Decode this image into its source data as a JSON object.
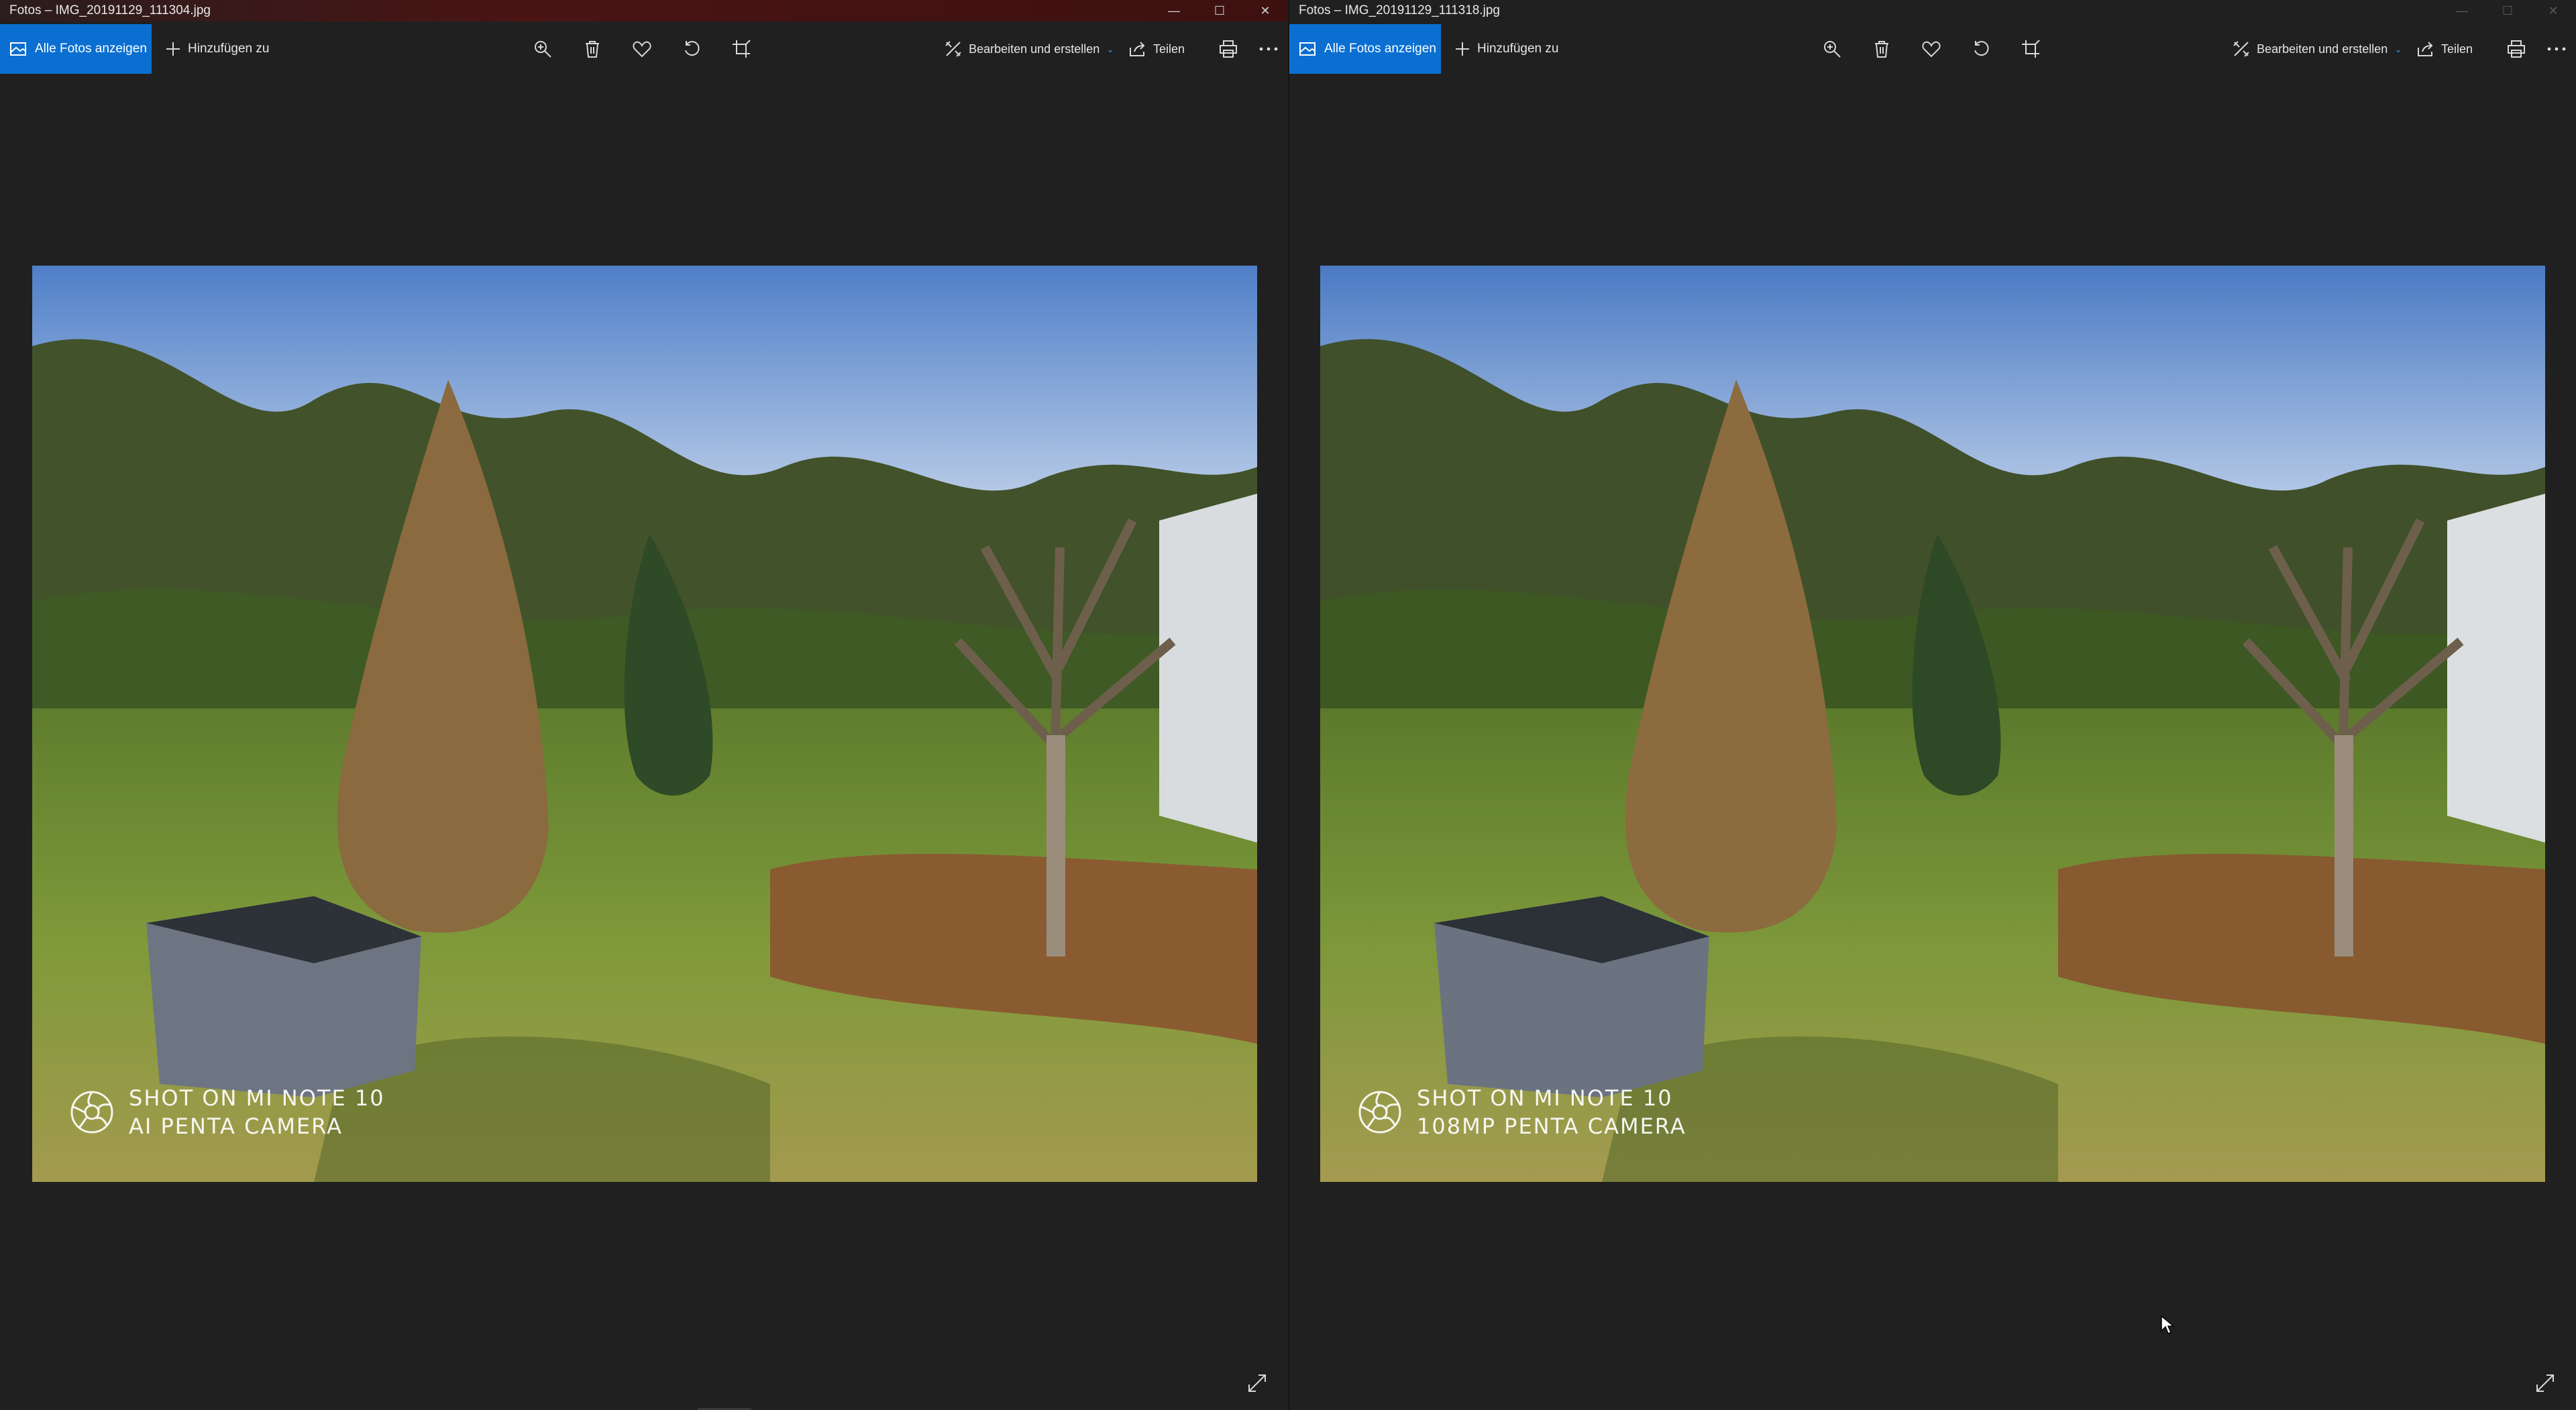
{
  "left": {
    "title": "Fotos – IMG_20191129_111304.jpg",
    "toolbar": {
      "all_photos_label": "Alle Fotos anzeigen",
      "add_label": "Hinzufügen zu",
      "edit_label": "Bearbeiten und erstellen",
      "share_label": "Teilen"
    },
    "watermark": {
      "line1": "SHOT ON MI NOTE 10",
      "line2": "AI PENTA CAMERA"
    }
  },
  "right": {
    "title": "Fotos – IMG_20191129_111318.jpg",
    "toolbar": {
      "all_photos_label": "Alle Fotos anzeigen",
      "add_label": "Hinzufügen zu",
      "edit_label": "Bearbeiten und erstellen",
      "share_label": "Teilen"
    },
    "watermark": {
      "line1": "SHOT ON MI NOTE 10",
      "line2": "108MP PENTA CAMERA"
    }
  },
  "icons": [
    "zoom-icon",
    "delete-icon",
    "favorite-icon",
    "rotate-icon",
    "crop-icon",
    "edit-icon",
    "share-icon",
    "print-icon",
    "more-icon",
    "expand-icon"
  ],
  "colors": {
    "accent": "#0a6fd1",
    "background": "#202020"
  }
}
